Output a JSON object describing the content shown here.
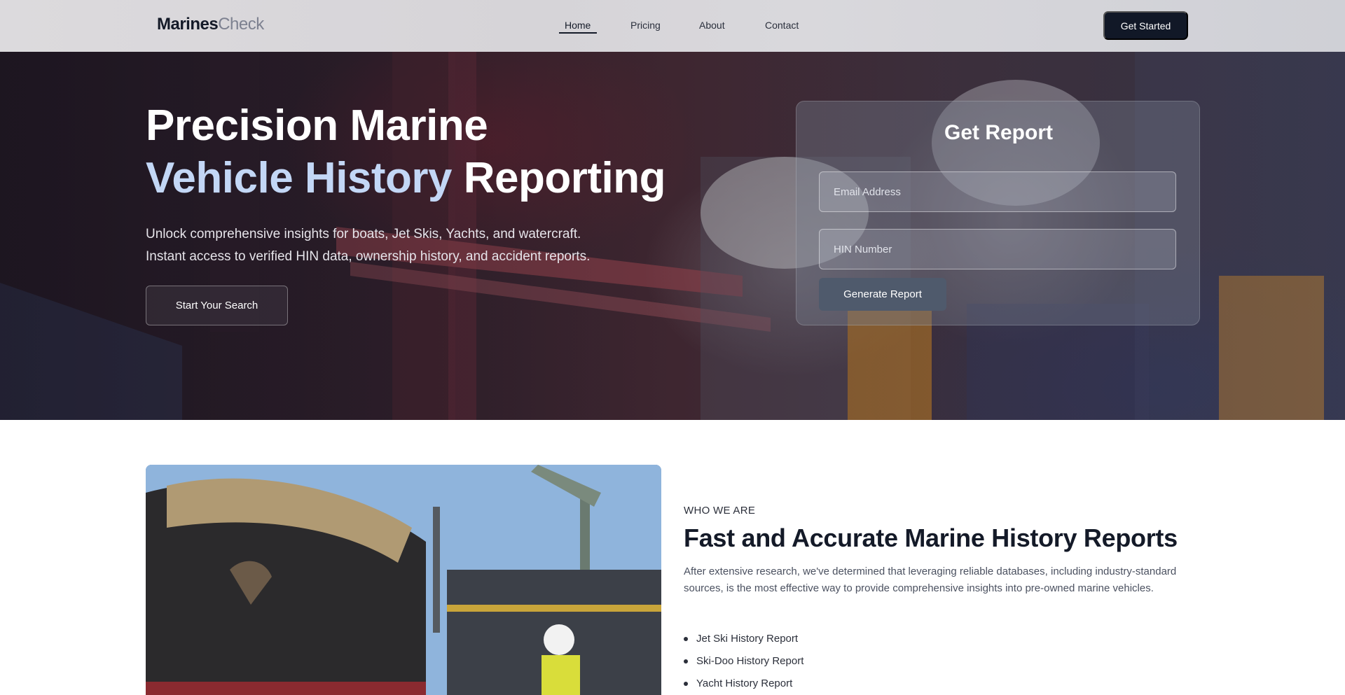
{
  "header": {
    "logo_bold": "Marines",
    "logo_light": "Check",
    "nav": [
      {
        "label": "Home",
        "active": true
      },
      {
        "label": "Pricing",
        "active": false
      },
      {
        "label": "About",
        "active": false
      },
      {
        "label": "Contact",
        "active": false
      }
    ],
    "cta_label": "Get Started"
  },
  "hero": {
    "title_line1": "Precision Marine",
    "title_highlight": "Vehicle History",
    "title_rest": "Reporting",
    "subtitle_line1": "Unlock comprehensive insights for boats, Jet Skis, Yachts, and watercraft.",
    "subtitle_line2": "Instant access to verified HIN data, ownership history, and accident reports.",
    "search_button": "Start Your Search"
  },
  "report_form": {
    "title": "Get Report",
    "email_placeholder": "Email Address",
    "hin_placeholder": "HIN Number",
    "submit_label": "Generate Report"
  },
  "about": {
    "eyebrow": "WHO WE ARE",
    "title": "Fast and Accurate Marine History Reports",
    "text": "After extensive research, we've determined that leveraging reliable databases, including industry-standard sources, is the most effective way to provide comprehensive insights into pre-owned marine vehicles.",
    "list": [
      "Jet Ski History Report",
      "Ski-Doo History Report",
      "Yacht History Report"
    ]
  },
  "colors": {
    "brand_dark": "#111827",
    "highlight": "#c3d7f6"
  }
}
